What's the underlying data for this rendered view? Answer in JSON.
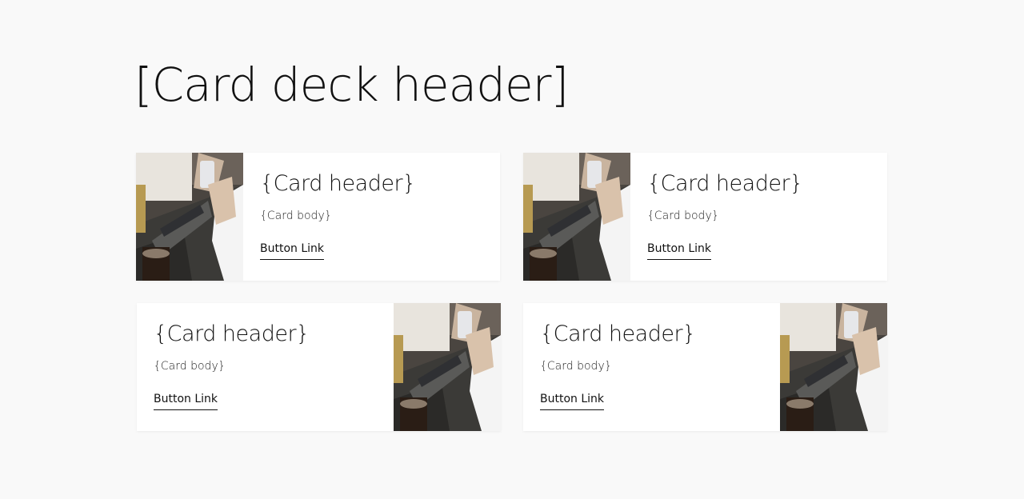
{
  "deck": {
    "title": "[Card deck header]"
  },
  "cards": [
    {
      "header": "{Card header}",
      "body": "{Card body}",
      "link": "Button Link",
      "image_position": "left"
    },
    {
      "header": "{Card header}",
      "body": "{Card body}",
      "link": "Button Link",
      "image_position": "left"
    },
    {
      "header": "{Card header}",
      "body": "{Card body}",
      "link": "Button Link",
      "image_position": "right"
    },
    {
      "header": "{Card header}",
      "body": "{Card body}",
      "link": "Button Link",
      "image_position": "right"
    }
  ],
  "colors": {
    "background": "#f9f9f9",
    "card": "#ffffff",
    "text": "#111111"
  }
}
